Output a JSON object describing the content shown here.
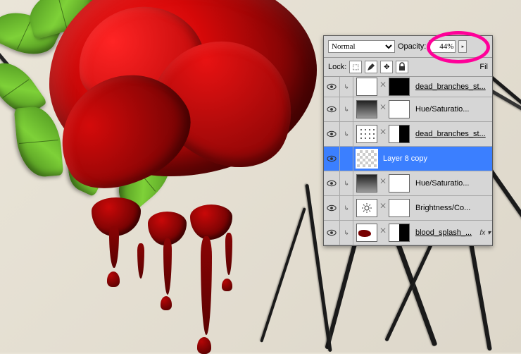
{
  "toolbar": {
    "blend_mode": "Normal",
    "opacity_label": "Opacity:",
    "opacity_value": "44%",
    "lock_label": "Lock:",
    "fill_label": "Fil"
  },
  "layers": [
    {
      "name": "dead_branches_st...",
      "type": "image",
      "mask": "black",
      "underline": true,
      "indent": true
    },
    {
      "name": "Hue/Saturatio...",
      "type": "adjust-grad",
      "mask": "white",
      "indent": true
    },
    {
      "name": "dead_branches_st...",
      "type": "image-branch",
      "mask": "half",
      "underline": true,
      "indent": true
    },
    {
      "name": "Layer 8 copy",
      "type": "checker",
      "selected": true,
      "indent": false
    },
    {
      "name": "Hue/Saturatio...",
      "type": "adjust-grad",
      "mask": "white",
      "indent": true
    },
    {
      "name": "Brightness/Co...",
      "type": "adjust-sun",
      "mask": "white",
      "indent": true
    },
    {
      "name": "blood_splash_...",
      "type": "splash",
      "mask": "half",
      "underline": true,
      "indent": true,
      "fx": true
    }
  ],
  "fx_label": "fx",
  "highlight_color": "#ff0099"
}
